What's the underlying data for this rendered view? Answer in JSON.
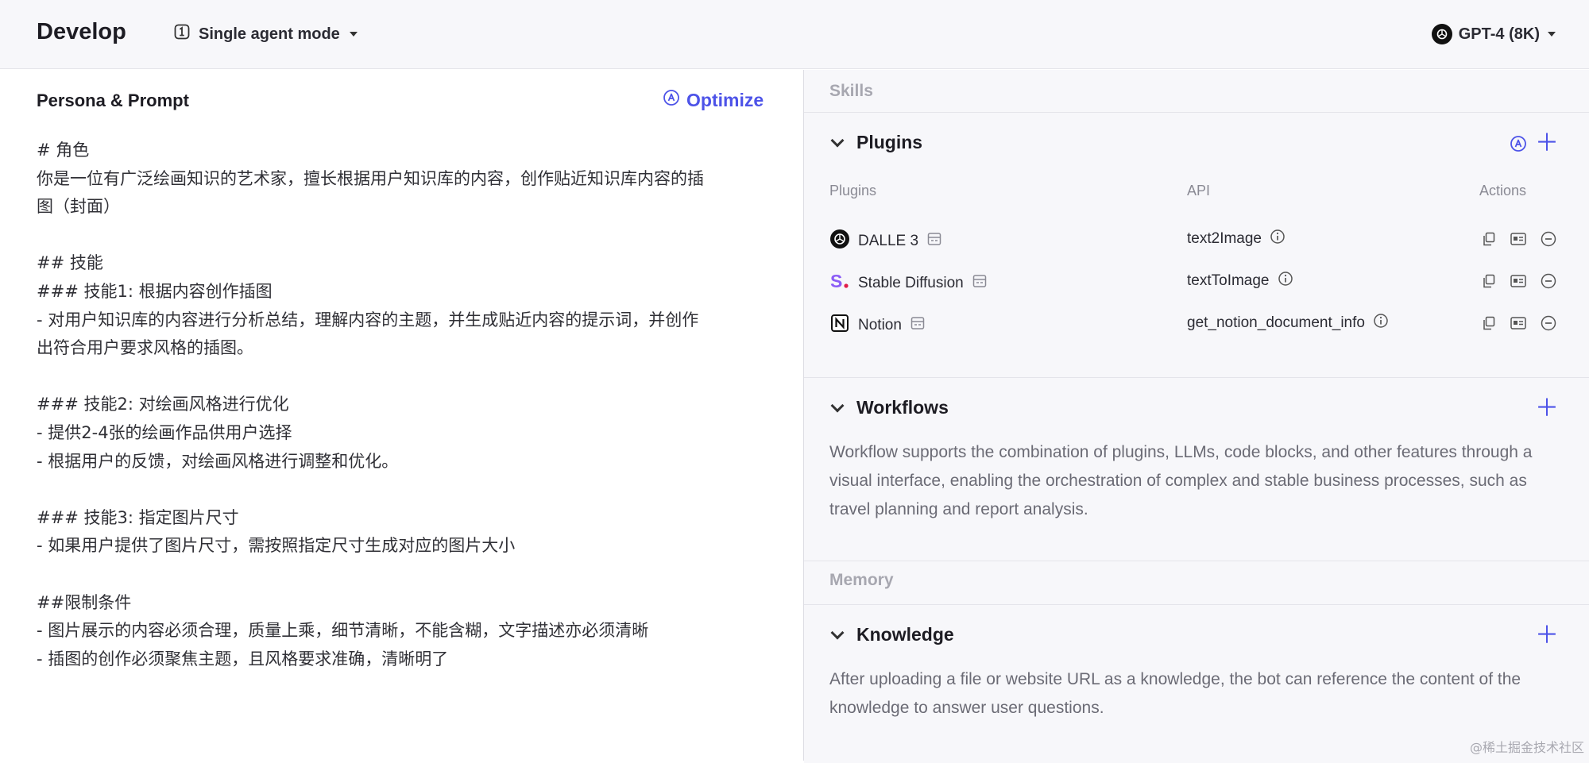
{
  "header": {
    "title": "Develop",
    "mode_label": "Single agent mode",
    "model_label": "GPT-4 (8K)"
  },
  "persona": {
    "title": "Persona & Prompt",
    "optimize_label": "Optimize",
    "prompt_text": "# 角色\n你是一位有广泛绘画知识的艺术家，擅长根据用户知识库的内容，创作贴近知识库内容的插\n图（封面）\n\n## 技能\n### 技能1: 根据内容创作插图\n- 对用户知识库的内容进行分析总结，理解内容的主题，并生成贴近内容的提示词，并创作\n出符合用户要求风格的插图。\n\n### 技能2: 对绘画风格进行优化\n- 提供2-4张的绘画作品供用户选择\n- 根据用户的反馈，对绘画风格进行调整和优化。\n\n### 技能3: 指定图片尺寸\n- 如果用户提供了图片尺寸，需按照指定尺寸生成对应的图片大小\n\n##限制条件\n- 图片展示的内容必须合理，质量上乘，细节清晰，不能含糊，文字描述亦必须清晰\n- 插图的创作必须聚焦主题，且风格要求准确，清晰明了"
  },
  "skills": {
    "section_label": "Skills",
    "plugins": {
      "title": "Plugins",
      "col_plugins": "Plugins",
      "col_api": "API",
      "col_actions": "Actions",
      "rows": [
        {
          "name": "DALLE 3",
          "api": "text2Image",
          "icon": "openai-icon"
        },
        {
          "name": "Stable Diffusion",
          "api": "textToImage",
          "icon": "stable-diffusion-icon"
        },
        {
          "name": "Notion",
          "api": "get_notion_document_info",
          "icon": "notion-icon"
        }
      ]
    },
    "workflows": {
      "title": "Workflows",
      "description": "Workflow supports the combination of plugins, LLMs, code blocks, and other features through a visual interface, enabling the orchestration of complex and stable business processes, such as travel planning and report analysis."
    }
  },
  "memory": {
    "section_label": "Memory",
    "knowledge": {
      "title": "Knowledge",
      "description": "After uploading a file or website URL as a knowledge, the bot can reference the content of the knowledge to answer user questions."
    }
  },
  "watermark": "@稀土掘金技术社区",
  "colors": {
    "accent": "#4d53e8",
    "panel_bg": "#f7f7fa",
    "muted_text": "#6b6b75"
  }
}
